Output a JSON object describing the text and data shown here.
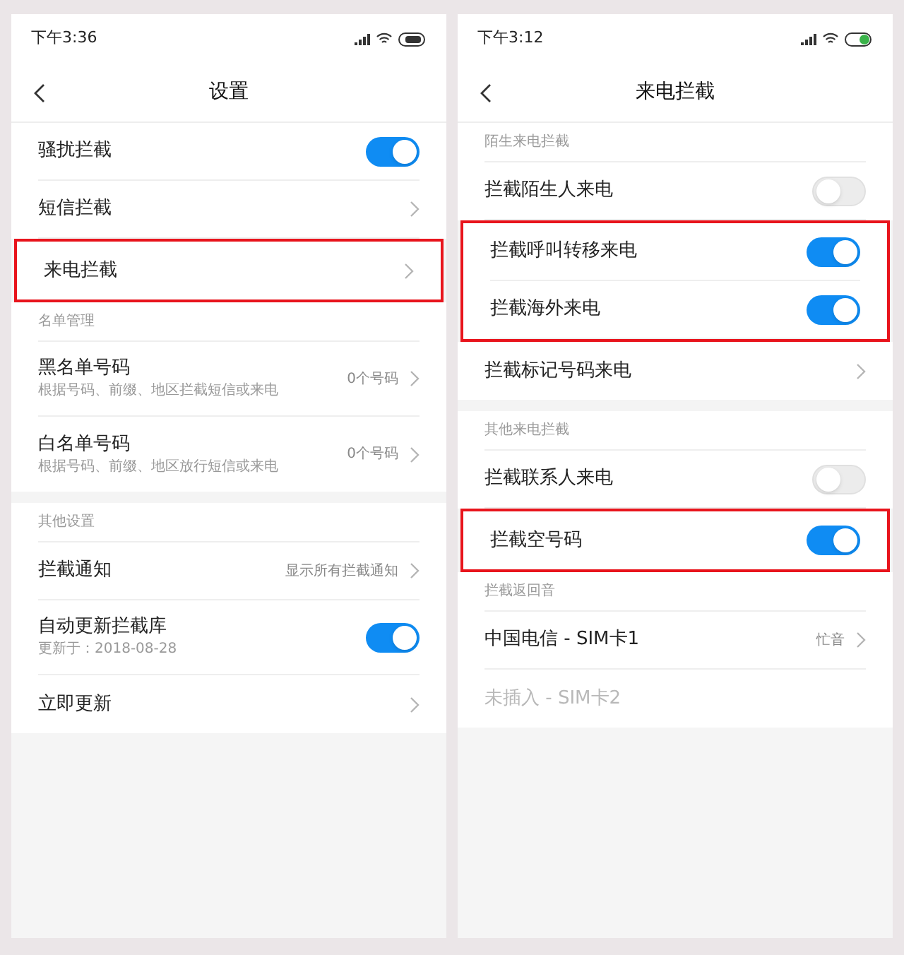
{
  "screens": [
    {
      "status_bar": {
        "time": "下午3:36",
        "charging": false
      },
      "title": "设置",
      "sections": [
        {
          "gap": false,
          "rows": [
            {
              "kind": "toggle",
              "label": "骚扰拦截",
              "on": true,
              "highlighted": false
            },
            {
              "kind": "link",
              "label": "短信拦截",
              "highlighted": false
            },
            {
              "kind": "link",
              "label": "来电拦截",
              "highlighted": true
            }
          ]
        },
        {
          "header": "名单管理",
          "gap": false,
          "rows": [
            {
              "kind": "link",
              "label": "黑名单号码",
              "subtitle": "根据号码、前缀、地区拦截短信或来电",
              "value": "0个号码",
              "highlighted": false
            },
            {
              "kind": "link",
              "label": "白名单号码",
              "subtitle": "根据号码、前缀、地区放行短信或来电",
              "value": "0个号码",
              "highlighted": false
            }
          ]
        },
        {
          "header": "其他设置",
          "gap": true,
          "rows": [
            {
              "kind": "link",
              "label": "拦截通知",
              "value": "显示所有拦截通知",
              "highlighted": false
            },
            {
              "kind": "toggle",
              "label": "自动更新拦截库",
              "subtitle": "更新于：2018-08-28",
              "on": true,
              "highlighted": false
            },
            {
              "kind": "link",
              "label": "立即更新",
              "highlighted": false
            }
          ]
        }
      ]
    },
    {
      "status_bar": {
        "time": "下午3:12",
        "charging": true
      },
      "title": "来电拦截",
      "sections": [
        {
          "header": "陌生来电拦截",
          "gap": false,
          "rows": [
            {
              "kind": "toggle",
              "label": "拦截陌生人来电",
              "on": false,
              "highlighted": false
            },
            {
              "kind": "toggle",
              "label": "拦截呼叫转移来电",
              "on": true,
              "highlighted": true
            },
            {
              "kind": "toggle",
              "label": "拦截海外来电",
              "on": true,
              "highlighted": true
            },
            {
              "kind": "link",
              "label": "拦截标记号码来电",
              "highlighted": false
            }
          ]
        },
        {
          "header": "其他来电拦截",
          "gap": true,
          "rows": [
            {
              "kind": "toggle",
              "label": "拦截联系人来电",
              "on": false,
              "highlighted": false
            },
            {
              "kind": "toggle",
              "label": "拦截空号码",
              "on": true,
              "highlighted": true
            }
          ]
        },
        {
          "header": "拦截返回音",
          "gap": false,
          "rows": [
            {
              "kind": "link",
              "label": "中国电信 - SIM卡1",
              "value": "忙音",
              "disabled": false,
              "highlighted": false
            },
            {
              "kind": "plain",
              "label": "未插入 - SIM卡2",
              "disabled": true,
              "highlighted": false
            }
          ]
        }
      ]
    }
  ]
}
